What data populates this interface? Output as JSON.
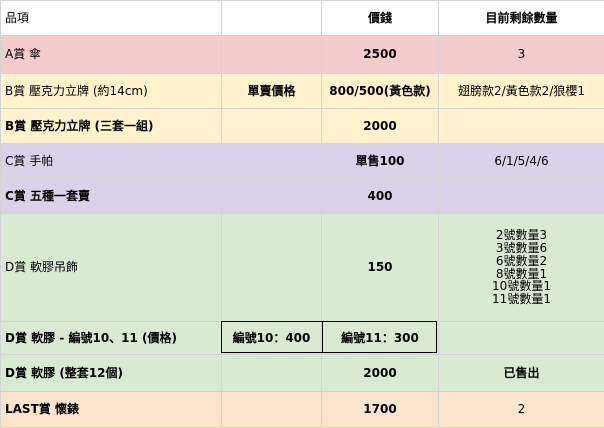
{
  "header": {
    "item": "品項",
    "col2": "",
    "price": "價錢",
    "stock": "目前剩餘數量"
  },
  "rows": [
    {
      "item": "A賞 傘",
      "col2": "",
      "price": "2500",
      "stock": "3"
    },
    {
      "item": "B賞 壓克力立牌 (約14cm)",
      "col2": "單賣價格",
      "price": "800/500(黃色款)",
      "stock": "翅膀款2/黃色款2/狼櫻1"
    },
    {
      "item": "B賞 壓克力立牌 (三套一組)",
      "col2": "",
      "price": "2000",
      "stock": ""
    },
    {
      "item": "C賞 手帕",
      "col2": "",
      "price": "單售100",
      "stock": "6/1/5/4/6"
    },
    {
      "item": "C賞 五種一套賣",
      "col2": "",
      "price": "400",
      "stock": ""
    },
    {
      "item": "D賞 軟膠吊飾",
      "col2": "",
      "price": "150",
      "stock_lines": [
        "2號數量3",
        "3號數量6",
        "6號數量2",
        "8號數量1",
        "10號數量1",
        "11號數量1"
      ]
    },
    {
      "item": "D賞 軟膠 - 編號10、11 (價格)",
      "col2": "編號10：400",
      "price": "編號11：300",
      "stock": ""
    },
    {
      "item": "D賞 軟膠 (整套12個)",
      "col2": "",
      "price": "2000",
      "stock": "已售出"
    },
    {
      "item": "LAST賞 懷錶",
      "col2": "",
      "price": "1700",
      "stock": "2"
    }
  ]
}
